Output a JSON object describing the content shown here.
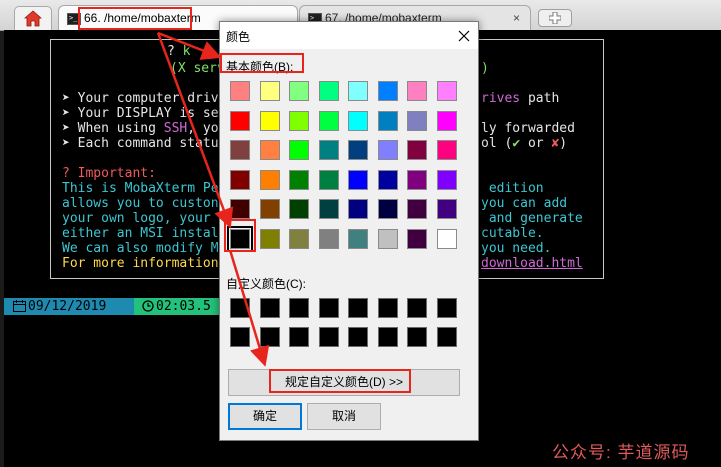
{
  "tabs": {
    "active_label": "66. /home/mobaxterm",
    "inactive_label": "67. /home/mobaxterm",
    "close_glyph": "×"
  },
  "terminal": {
    "line_title_partial": "? ",
    "line_title_k": "k",
    "line_x_partial": "(X serv",
    "line_x_end": ")",
    "bullet1_a": "➤ Your computer driv",
    "bullet1_b": "rives",
    "bullet1_c": " path",
    "bullet2_a": "➤ Your DISPLAY is se",
    "bullet3_a": "➤ When using ",
    "bullet3_ssh": "SSH",
    "bullet3_b": ", yo",
    "bullet3_c": "ly forwarded",
    "bullet4_a": "➤ Each command statu",
    "bullet4_b": "ol (",
    "bullet4_check": "✔",
    "bullet4_or": " or ",
    "bullet4_cross": "✘",
    "bullet4_close": ")",
    "important": "? Important:",
    "p1_left": "This is MobaXterm Pe",
    "p1_right": " edition",
    "p2_left": "allows you to custon",
    "p2_right": "you can add",
    "p3_left": "your own logo, your",
    "p3_right": " and generate",
    "p4_left": "either an MSI instal",
    "p4_right": "cutable.",
    "p5_left": "We can also modify M",
    "p5_right": "you need.",
    "p6_left": "For more information",
    "p6_link": "download.html",
    "status_date": " 09/12/2019 ",
    "status_time": " 02:03.5"
  },
  "watermark": "公众号: 芋道源码",
  "dialog": {
    "title": "颜色",
    "basic_label": "基本颜色(B):",
    "custom_label": "自定义颜色(C):",
    "define_button": "规定自定义颜色(D) >>",
    "ok_button": "确定",
    "cancel_button": "取消",
    "basic_colors": [
      "#ff8080",
      "#ffff80",
      "#80ff80",
      "#00ff80",
      "#80ffff",
      "#0080ff",
      "#ff80c0",
      "#ff80ff",
      "#ff0000",
      "#ffff00",
      "#80ff00",
      "#00ff40",
      "#00ffff",
      "#0080c0",
      "#8080c0",
      "#ff00ff",
      "#804040",
      "#ff8040",
      "#00ff00",
      "#008080",
      "#004080",
      "#8080ff",
      "#800040",
      "#ff0080",
      "#800000",
      "#ff8000",
      "#008000",
      "#008040",
      "#0000ff",
      "#0000a0",
      "#800080",
      "#8000ff",
      "#400000",
      "#804000",
      "#004000",
      "#004040",
      "#000080",
      "#000040",
      "#400040",
      "#400080",
      "#000000",
      "#808000",
      "#808040",
      "#808080",
      "#408080",
      "#c0c0c0",
      "#400040",
      "#ffffff"
    ],
    "selected_index": 40
  }
}
